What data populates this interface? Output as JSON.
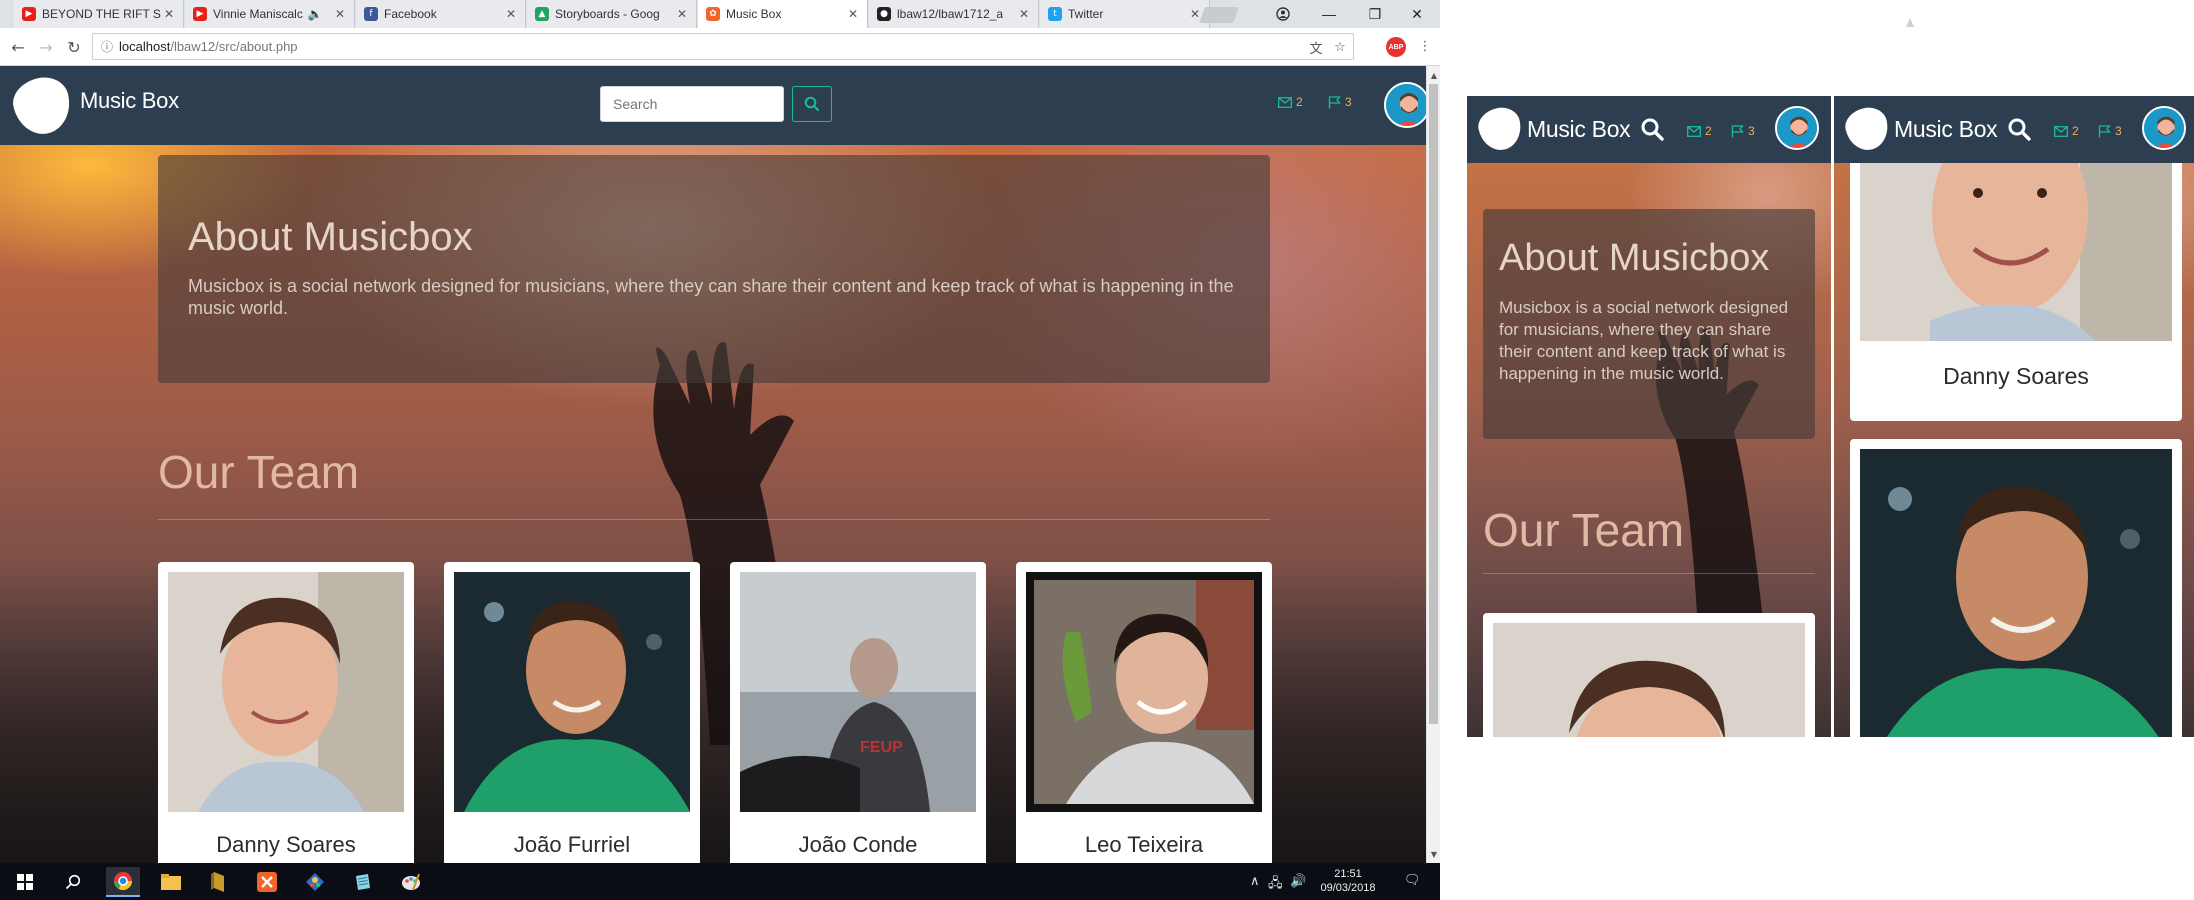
{
  "browser": {
    "tabs": [
      {
        "label": "BEYOND THE RIFT S",
        "favicon_color": "#e62117",
        "favicon_icon": "youtube-icon",
        "active": false
      },
      {
        "label": "Vinnie Maniscalc",
        "favicon_color": "#e62117",
        "favicon_icon": "youtube-icon",
        "active": false
      },
      {
        "label": "Facebook",
        "favicon_color": "#3b5998",
        "favicon_icon": "facebook-icon",
        "active": false
      },
      {
        "label": "Storyboards - Goog",
        "favicon_color": "#1fa463",
        "favicon_icon": "google-drive-icon",
        "active": false
      },
      {
        "label": "Music Box",
        "favicon_color": "#f16529",
        "favicon_icon": "xampp-icon",
        "active": true
      },
      {
        "label": "lbaw12/lbaw1712_a",
        "favicon_color": "#222222",
        "favicon_icon": "github-icon",
        "active": false
      },
      {
        "label": "Twitter",
        "favicon_color": "#1da1f2",
        "favicon_icon": "twitter-icon",
        "active": false
      }
    ],
    "url_host": "localhost",
    "url_path": "/lbaw12/src/about.php",
    "extension_badge": "ABP"
  },
  "site": {
    "brand": "Music Box",
    "search_placeholder": "Search",
    "messages_count": "2",
    "notifications_count": "3",
    "accent_color": "#18bc9c",
    "navbar_color": "#2c3e50"
  },
  "about": {
    "title": "About Musicbox",
    "text": "Musicbox is a social network designed for musicians, where they can share their content and keep track of what is happening in the music world."
  },
  "team": {
    "title": "Our Team",
    "members": [
      {
        "name": "Danny Soares"
      },
      {
        "name": "João Furriel"
      },
      {
        "name": "João Conde"
      },
      {
        "name": "Leo Teixeira"
      }
    ]
  },
  "taskbar": {
    "time": "21:51",
    "date": "09/03/2018",
    "apps": [
      "windows-start-icon",
      "search-icon",
      "chrome-icon",
      "file-explorer-icon",
      "app-icon",
      "xampp-icon",
      "sourcetree-icon",
      "notepad-icon",
      "paint-icon"
    ]
  },
  "mobile_previews": [
    {
      "brand": "Music Box",
      "messages_count": "2",
      "notifications_count": "3",
      "about_title": "About Musicbox",
      "about_text": "Musicbox is a social network designed for musicians, where they can share their content and keep track of what is happening in the music world.",
      "team_title": "Our Team"
    },
    {
      "brand": "Music Box",
      "messages_count": "2",
      "notifications_count": "3",
      "member_name": "Danny Soares"
    }
  ]
}
